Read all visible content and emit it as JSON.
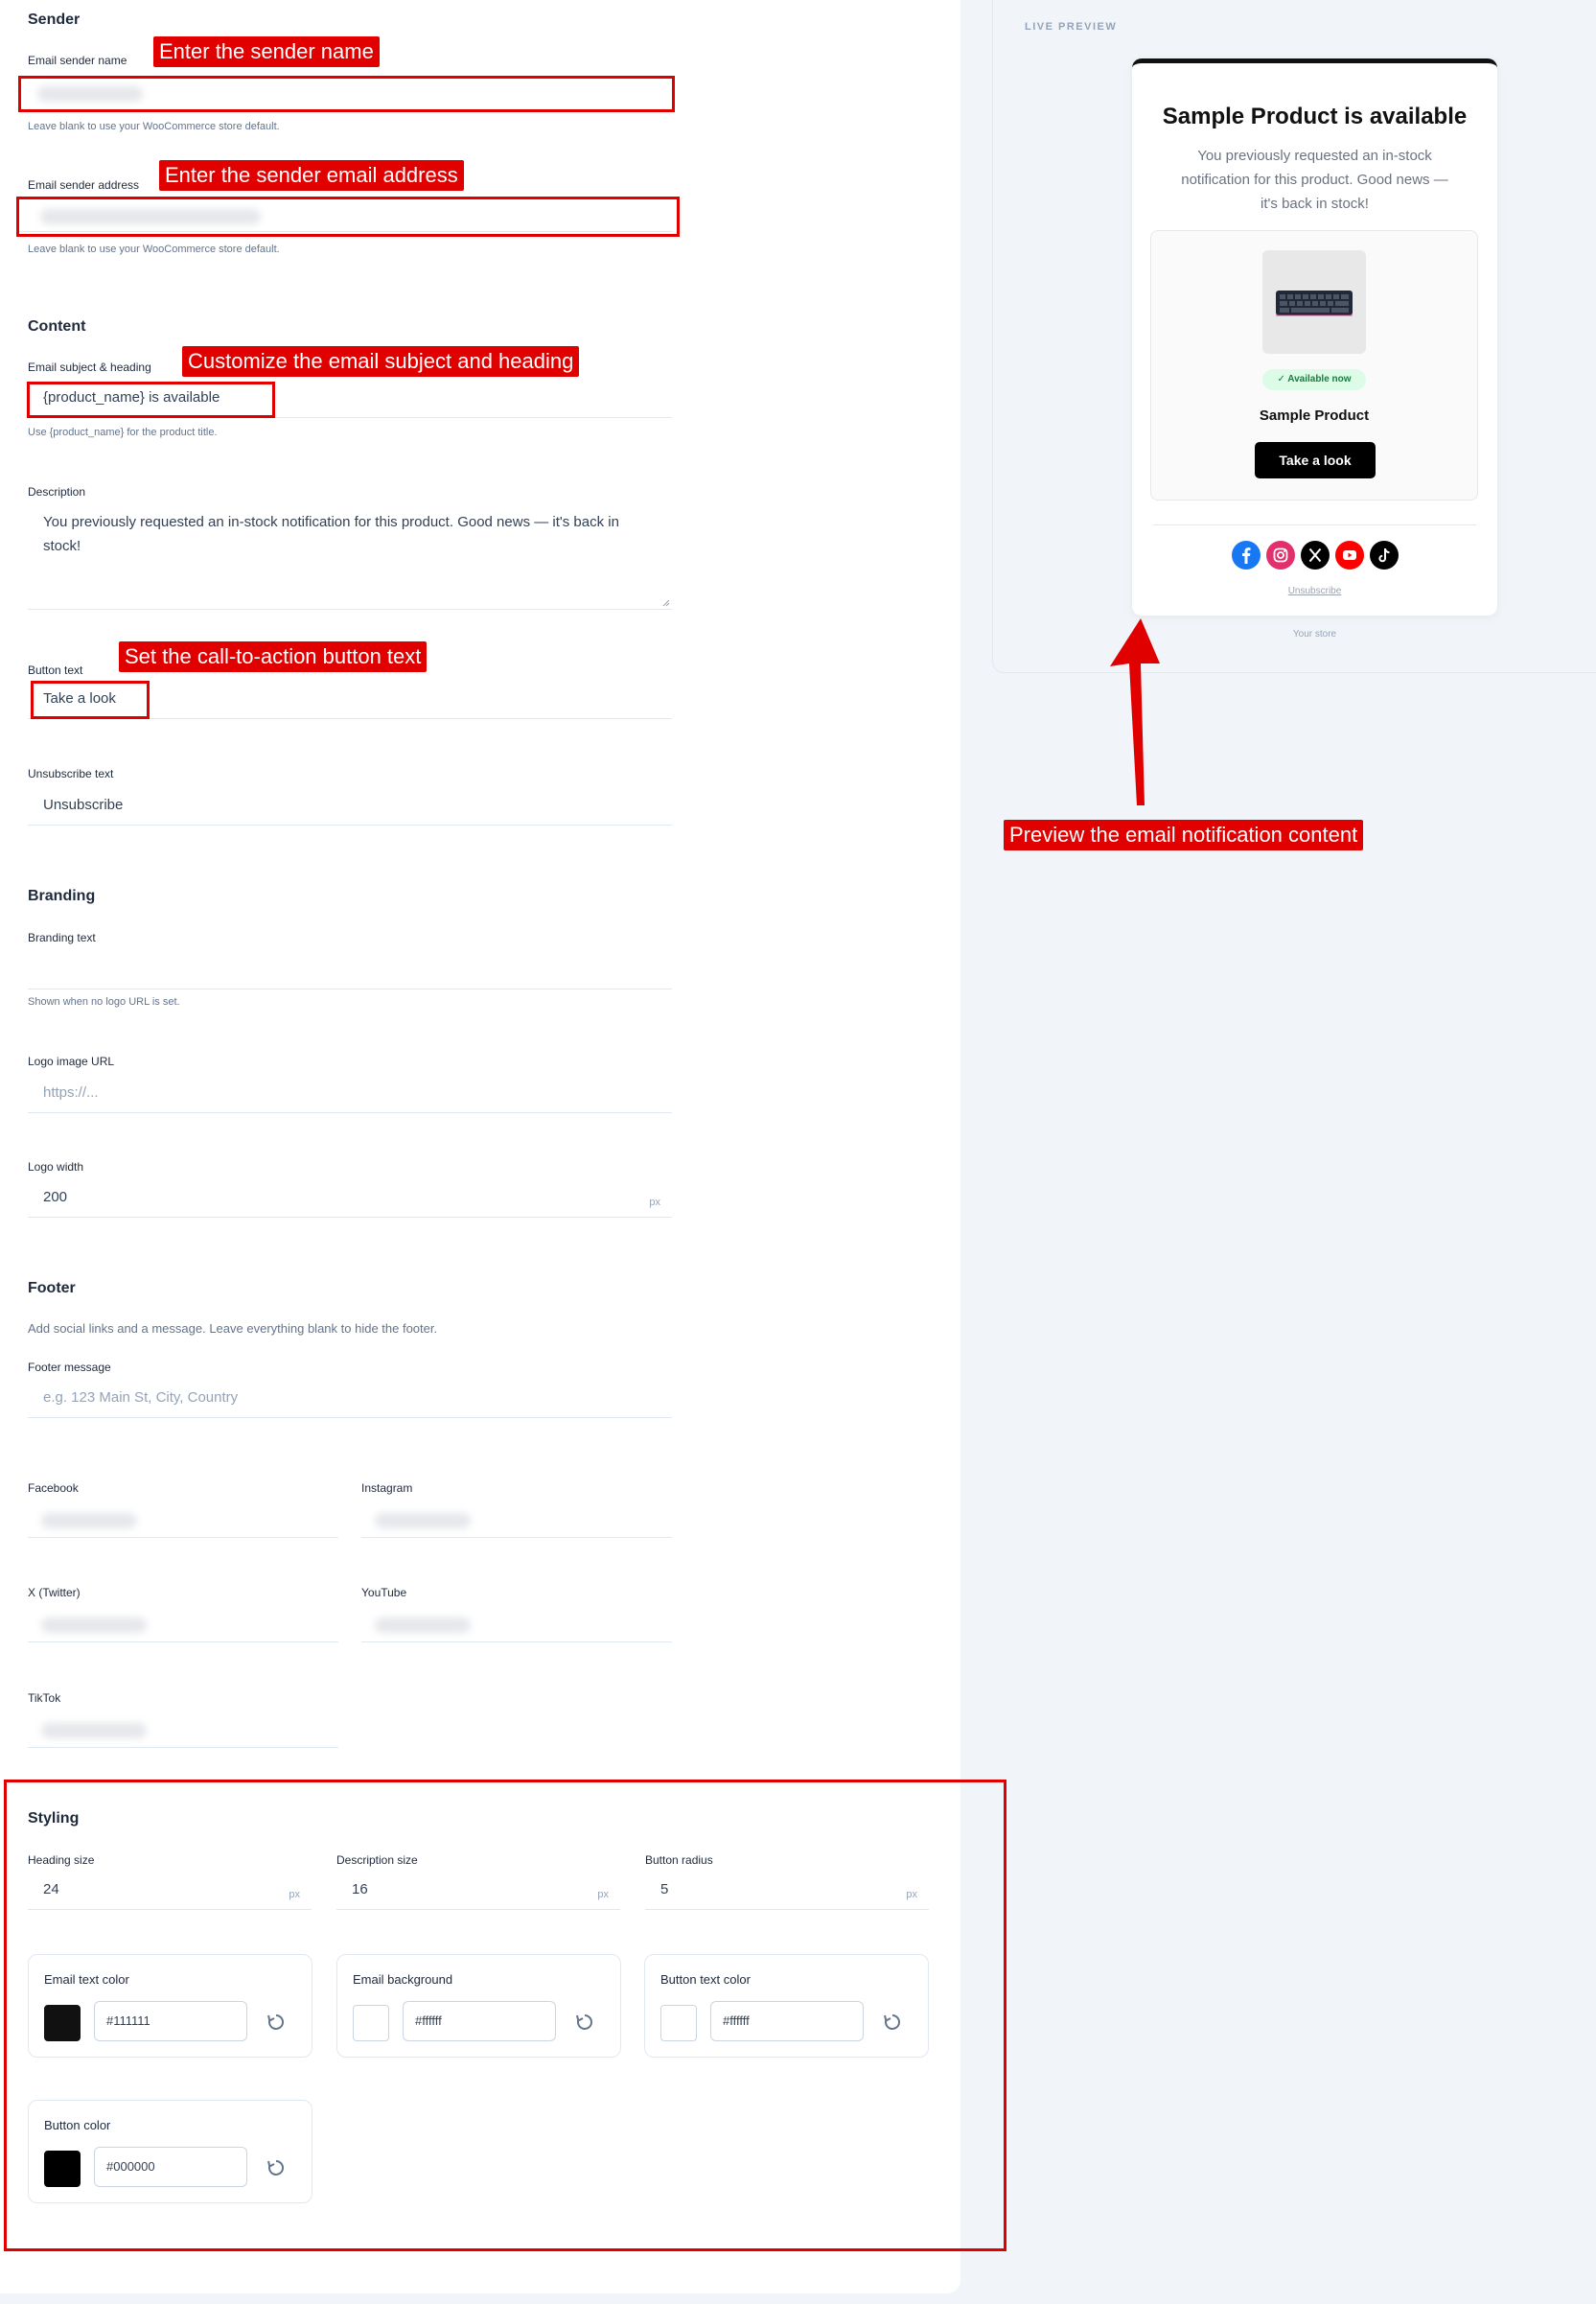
{
  "sender": {
    "section_title": "Sender",
    "name_label": "Email sender name",
    "name_help": "Leave blank to use your WooCommerce store default.",
    "address_label": "Email sender address",
    "address_help": "Leave blank to use your WooCommerce store default."
  },
  "content": {
    "section_title": "Content",
    "subject_label": "Email subject & heading",
    "subject_value": "{product_name} is available",
    "subject_help": "Use {product_name} for the product title.",
    "description_label": "Description",
    "description_value": "You previously requested an in-stock notification for this product. Good news — it's back in stock!",
    "button_text_label": "Button text",
    "button_text_value": "Take a look",
    "unsubscribe_label": "Unsubscribe text",
    "unsubscribe_value": "Unsubscribe"
  },
  "branding": {
    "section_title": "Branding",
    "text_label": "Branding text",
    "text_help": "Shown when no logo URL is set.",
    "logo_url_label": "Logo image URL",
    "logo_url_placeholder": "https://...",
    "logo_width_label": "Logo width",
    "logo_width_value": "200",
    "logo_width_unit": "px"
  },
  "footer": {
    "section_title": "Footer",
    "intro": "Add social links and a message. Leave everything blank to hide the footer.",
    "message_label": "Footer message",
    "message_placeholder": "e.g. 123 Main St, City, Country",
    "facebook_label": "Facebook",
    "instagram_label": "Instagram",
    "twitter_label": "X (Twitter)",
    "youtube_label": "YouTube",
    "tiktok_label": "TikTok"
  },
  "styling": {
    "section_title": "Styling",
    "heading_size_label": "Heading size",
    "heading_size_value": "24",
    "description_size_label": "Description size",
    "description_size_value": "16",
    "button_radius_label": "Button radius",
    "button_radius_value": "5",
    "unit": "px",
    "email_text_color_label": "Email text color",
    "email_text_color_value": "#111111",
    "email_background_label": "Email background",
    "email_background_value": "#ffffff",
    "button_text_color_label": "Button text color",
    "button_text_color_value": "#ffffff",
    "button_color_label": "Button color",
    "button_color_value": "#000000"
  },
  "annotations": {
    "sender_name": "Enter the sender name",
    "sender_address": "Enter the sender email address",
    "subject": "Customize the email subject and heading",
    "button_text": "Set the call-to-action button text",
    "preview": "Preview the email notification content"
  },
  "preview": {
    "label": "LIVE PREVIEW",
    "heading": "Sample Product is available",
    "description": "You previously requested an in-stock notification for this product. Good news — it's back in stock!",
    "badge": "✓ Available now",
    "product_name": "Sample Product",
    "button": "Take a look",
    "unsubscribe": "Unsubscribe",
    "store_footer": "Your store",
    "social_icons": [
      "facebook-icon",
      "instagram-icon",
      "x-twitter-icon",
      "youtube-icon",
      "tiktok-icon"
    ]
  },
  "colors": {
    "annotation_red": "#e00000",
    "accent_black": "#000000",
    "badge_green": "#15803d",
    "facebook": "#1877f2",
    "instagram": "#e1306c",
    "youtube": "#ff0000"
  }
}
